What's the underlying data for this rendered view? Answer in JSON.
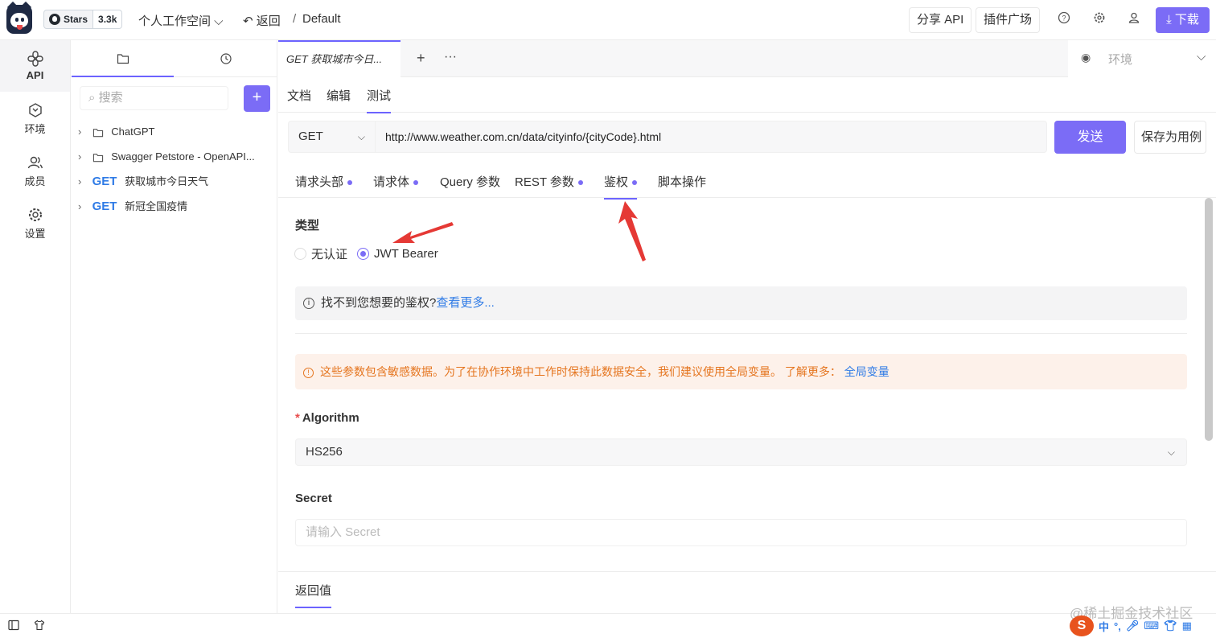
{
  "topbar": {
    "github_stars_label": "Stars",
    "github_stars_count": "3.3k",
    "workspace": "个人工作空间",
    "back_label": "返回",
    "crumb_sep": "/",
    "crumb": "Default",
    "share_api": "分享 API",
    "plugins": "插件广场",
    "download": "下载"
  },
  "nav": {
    "items": [
      {
        "label": "API",
        "icon": "api-icon"
      },
      {
        "label": "环境",
        "icon": "environment-icon"
      },
      {
        "label": "成员",
        "icon": "members-icon"
      },
      {
        "label": "设置",
        "icon": "settings-icon"
      }
    ]
  },
  "tree": {
    "search_placeholder": "搜索",
    "items": [
      {
        "type": "folder",
        "label": "ChatGPT"
      },
      {
        "type": "folder",
        "label": "Swagger Petstore - OpenAPI..."
      },
      {
        "type": "api",
        "method": "GET",
        "label": "获取城市今日天气"
      },
      {
        "type": "api",
        "method": "GET",
        "label": "新冠全国疫情"
      }
    ]
  },
  "main": {
    "open_tab": "GET 获取城市今日...",
    "env_placeholder": "环境",
    "subtabs": [
      "文档",
      "编辑",
      "测试"
    ],
    "active_subtab": "测试",
    "method": "GET",
    "url": "http://www.weather.com.cn/data/cityinfo/{cityCode}.html",
    "send": "发送",
    "save_as_case": "保存为用例",
    "param_tabs": [
      "请求头部",
      "请求体",
      "Query 参数",
      "REST 参数",
      "鉴权",
      "脚本操作"
    ],
    "active_param_tab": "鉴权",
    "auth": {
      "type_title": "类型",
      "options": [
        "无认证",
        "JWT Bearer"
      ],
      "selected": "JWT Bearer",
      "info_text": "找不到您想要的鉴权?",
      "info_link": "查看更多...",
      "warning_text": "这些参数包含敏感数据。为了在协作环境中工作时保持此数据安全，我们建议使用全局变量。 了解更多：",
      "warning_link": "全局变量",
      "algorithm_label": "Algorithm",
      "algorithm_value": "HS256",
      "secret_label": "Secret",
      "secret_placeholder": "请输入 Secret"
    },
    "response_tab": "返回值"
  },
  "watermark": "@稀土掘金技术社区",
  "ime": {
    "logo": "S",
    "lang": "中"
  },
  "colors": {
    "accent": "#7b6cf6",
    "link": "#2f7be6",
    "warning": "#e5751f",
    "arrow": "#e53935"
  }
}
